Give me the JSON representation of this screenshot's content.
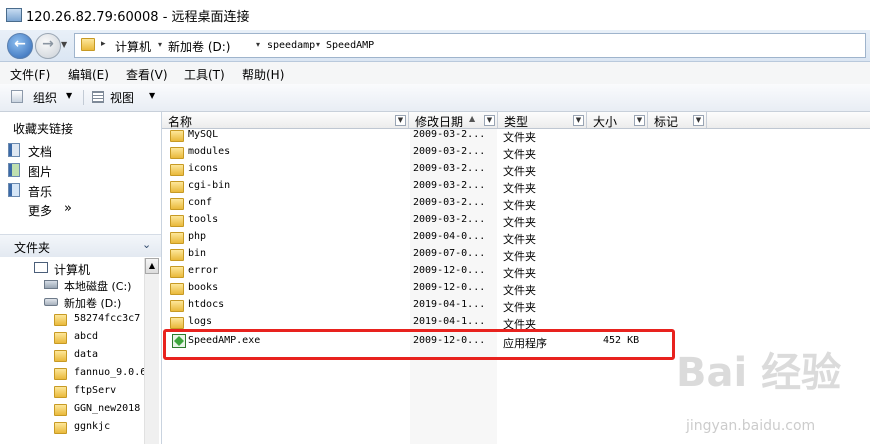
{
  "window": {
    "title": "120.26.82.79:60008 - 远程桌面连接"
  },
  "address": {
    "breadcrumbs": [
      "计算机",
      "新加卷 (D:)",
      "speedamp",
      "SpeedAMP"
    ]
  },
  "menu": {
    "items": [
      "文件(F)",
      "编辑(E)",
      "查看(V)",
      "工具(T)",
      "帮助(H)"
    ]
  },
  "toolbar": {
    "organize": "组织",
    "views": "视图"
  },
  "nav": {
    "favorites_title": "收藏夹链接",
    "favorites": [
      {
        "label": "文档",
        "icon": "document-icon"
      },
      {
        "label": "图片",
        "icon": "picture-icon"
      },
      {
        "label": "音乐",
        "icon": "music-icon"
      }
    ],
    "more": "更多",
    "more_arrows": "»",
    "folders_title": "文件夹",
    "tree": {
      "computer": "计算机",
      "drive_c": "本地磁盘 (C:)",
      "drive_d": "新加卷 (D:)",
      "folders": [
        "58274fcc3c7",
        "abcd",
        "data",
        "fannuo_9.0.6",
        "ftpServ",
        "GGN_new2018",
        "ggnkjc"
      ]
    }
  },
  "columns": {
    "name": "名称",
    "date": "修改日期",
    "type": "类型",
    "size": "大小",
    "tags": "标记"
  },
  "files": [
    {
      "name": "MySQL",
      "date": "2009-03-2...",
      "type": "文件夹",
      "size": ""
    },
    {
      "name": "modules",
      "date": "2009-03-2...",
      "type": "文件夹",
      "size": ""
    },
    {
      "name": "icons",
      "date": "2009-03-2...",
      "type": "文件夹",
      "size": ""
    },
    {
      "name": "cgi-bin",
      "date": "2009-03-2...",
      "type": "文件夹",
      "size": ""
    },
    {
      "name": "conf",
      "date": "2009-03-2...",
      "type": "文件夹",
      "size": ""
    },
    {
      "name": "tools",
      "date": "2009-03-2...",
      "type": "文件夹",
      "size": ""
    },
    {
      "name": "php",
      "date": "2009-04-0...",
      "type": "文件夹",
      "size": ""
    },
    {
      "name": "bin",
      "date": "2009-07-0...",
      "type": "文件夹",
      "size": ""
    },
    {
      "name": "error",
      "date": "2009-12-0...",
      "type": "文件夹",
      "size": ""
    },
    {
      "name": "books",
      "date": "2009-12-0...",
      "type": "文件夹",
      "size": ""
    },
    {
      "name": "htdocs",
      "date": "2019-04-1...",
      "type": "文件夹",
      "size": ""
    },
    {
      "name": "logs",
      "date": "2019-04-1...",
      "type": "文件夹",
      "size": ""
    },
    {
      "name": "SpeedAMP.exe",
      "date": "2009-12-0...",
      "type": "应用程序",
      "size": "452 KB"
    }
  ],
  "watermark": {
    "text": "Bai 经验",
    "sub": "jingyan.baidu.com"
  },
  "colors": {
    "highlight": "#e8221e",
    "folder": "#e9b93b",
    "nav_back": "#2e66b4"
  }
}
